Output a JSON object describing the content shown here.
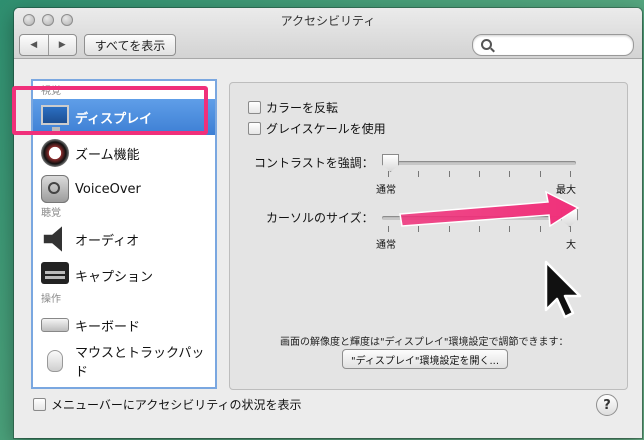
{
  "window": {
    "title": "アクセシビリティ"
  },
  "toolbar": {
    "back": "◀",
    "forward": "▶",
    "show_all": "すべてを表示",
    "search_placeholder": ""
  },
  "sidebar": {
    "sections": [
      {
        "label": "視覚",
        "items": [
          {
            "label": "ディスプレイ",
            "icon": "display-icon",
            "selected": true
          },
          {
            "label": "ズーム機能",
            "icon": "zoom-icon"
          },
          {
            "label": "VoiceOver",
            "icon": "voiceover-icon"
          }
        ]
      },
      {
        "label": "聴覚",
        "items": [
          {
            "label": "オーディオ",
            "icon": "speaker-icon"
          },
          {
            "label": "キャプション",
            "icon": "caption-icon"
          }
        ]
      },
      {
        "label": "操作",
        "items": [
          {
            "label": "キーボード",
            "icon": "keyboard-icon"
          },
          {
            "label": "マウスとトラックパッド",
            "icon": "mouse-icon"
          }
        ]
      }
    ]
  },
  "display": {
    "invert_colors": "カラーを反転",
    "grayscale": "グレイスケールを使用",
    "contrast_label": "コントラストを強調：",
    "contrast_min": "通常",
    "contrast_max": "最大",
    "contrast_value": 0.0,
    "cursor_label": "カーソルのサイズ：",
    "cursor_min": "通常",
    "cursor_max": "大",
    "cursor_value": 1.0,
    "note": "画面の解像度と輝度は\"ディスプレイ\"環境設定で調節できます：",
    "open_button": "\"ディスプレイ\"環境設定を開く..."
  },
  "footer": {
    "menubar_status": "メニューバーにアクセシビリティの状況を表示",
    "help": "?"
  },
  "colors": {
    "annotation": "#f0307a",
    "selection": "#3d7fd4"
  }
}
